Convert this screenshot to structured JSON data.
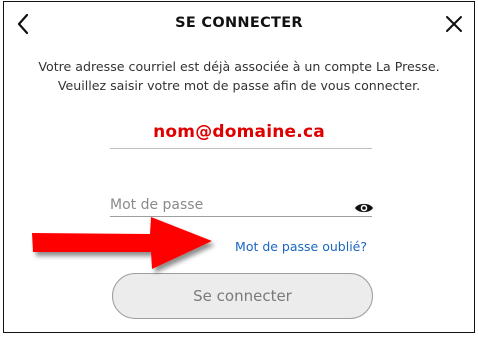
{
  "dialog": {
    "title": "SE CONNECTER",
    "back_icon": "chevron-left-icon",
    "close_icon": "close-icon",
    "message": "Votre adresse courriel est déjà associée à un compte La Presse. Veuillez saisir votre mot de passe afin de vous connecter.",
    "email_value": "nom@domaine.ca",
    "password_placeholder": "Mot de passe",
    "password_value": "",
    "show_password_icon": "eye-icon",
    "forgot_link": "Mot de passe oublié?",
    "submit_label": "Se connecter"
  },
  "annotation": {
    "arrow_icon": "red-arrow-icon",
    "arrow_color": "#ff0000"
  },
  "colors": {
    "email_text": "#e00000",
    "link": "#1a66c2",
    "button_bg": "#ececec",
    "button_text": "#7a7a7a"
  }
}
